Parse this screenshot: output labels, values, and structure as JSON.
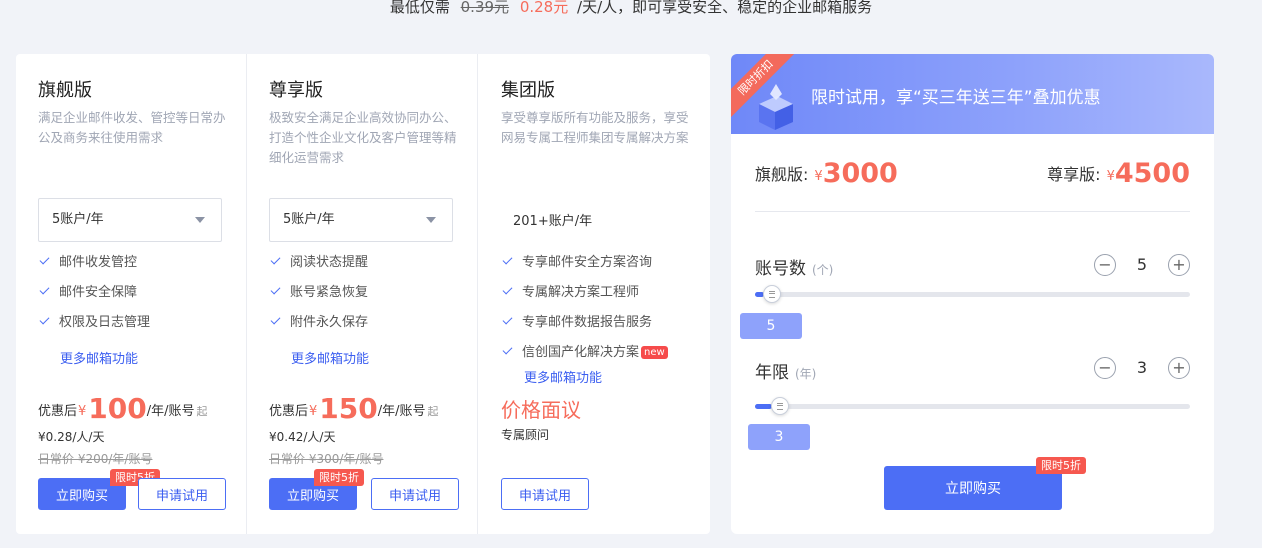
{
  "header": {
    "prefix": "最低仅需",
    "old_price": "0.39元",
    "new_price": "0.28元",
    "suffix": "/天/人，即可享受安全、稳定的企业邮箱服务"
  },
  "plans": [
    {
      "title": "旗舰版",
      "desc": "满足企业邮件收发、管控等日常办公及商务来往使用需求",
      "account_select": "5账户/年",
      "features": [
        "邮件收发管控",
        "邮件安全保障",
        "权限及日志管理"
      ],
      "more_link": "更多邮箱功能",
      "price_prefix": "优惠后",
      "currency": "¥",
      "price": "100",
      "price_unit": "/年/账号",
      "price_from": "起",
      "per_day": "¥0.28/人/天",
      "original": "日常价 ¥200/年/账号",
      "buy_label": "立即购买",
      "limit_badge": "限时5折",
      "trial_label": "申请试用"
    },
    {
      "title": "尊享版",
      "desc": "极致安全满足企业高效协同办公、打造个性企业文化及客户管理等精细化运营需求",
      "account_select": "5账户/年",
      "features": [
        "阅读状态提醒",
        "账号紧急恢复",
        "附件永久保存"
      ],
      "more_link": "更多邮箱功能",
      "price_prefix": "优惠后",
      "currency": "¥",
      "price": "150",
      "price_unit": "/年/账号",
      "price_from": "起",
      "per_day": "¥0.42/人/天",
      "original": "日常价 ¥300/年/账号",
      "buy_label": "立即购买",
      "limit_badge": "限时5折",
      "trial_label": "申请试用"
    },
    {
      "title": "集团版",
      "desc": "享受尊享版所有功能及服务，享受网易专属工程师集团专属解决方案",
      "account_select": "201+账户/年",
      "features": [
        "专享邮件安全方案咨询",
        "专属解决方案工程师",
        "专享邮件数据报告服务",
        "信创国产化解决方案"
      ],
      "new_badge": "new",
      "more_link": "更多邮箱功能",
      "negotiable": "价格面议",
      "consultant": "专属顾问",
      "trial_label": "申请试用"
    }
  ],
  "promo": {
    "ribbon": "限时折扣",
    "banner_text": "限时试用，享“买三年送三年”叠加优惠",
    "flagship_label": "旗舰版:",
    "flagship_currency": "¥",
    "flagship_price": "3000",
    "premium_label": "尊享版:",
    "premium_currency": "¥",
    "premium_price": "4500",
    "accounts_label": "账号数",
    "accounts_unit": "(个)",
    "accounts_value": "5",
    "accounts_fraction": 0.02,
    "years_label": "年限",
    "years_unit": "(年)",
    "years_value": "3",
    "years_fraction": 0.04,
    "minus_symbol": "−",
    "plus_symbol": "+",
    "buy_label": "立即购买",
    "limit_badge": "限时5折"
  },
  "colors": {
    "accent": "#4c6ef5",
    "price_red": "#f66c5b",
    "badge_red": "#f6584f"
  }
}
